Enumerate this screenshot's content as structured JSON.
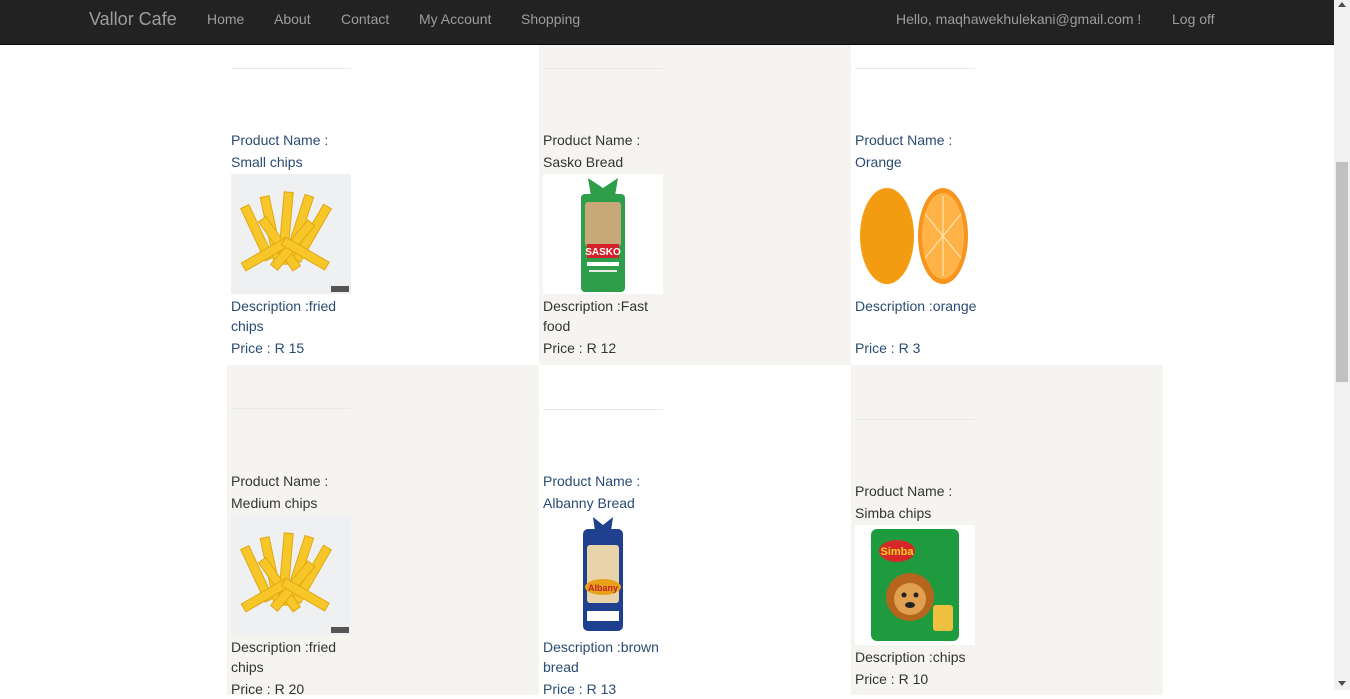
{
  "navbar": {
    "brand": "Vallor Cafe",
    "links": [
      "Home",
      "About",
      "Contact",
      "My Account",
      "Shopping"
    ],
    "greeting": "Hello, maqhawekhulekani@gmail.com !",
    "logoff": "Log off"
  },
  "labels": {
    "name": "Product Name :",
    "price_prefix": "Price : R "
  },
  "products": [
    {
      "name": "Small chips",
      "description": "Description :fried chips",
      "price": "Price : R 15",
      "image": "fries-image"
    },
    {
      "name": "Sasko Bread",
      "description": "Description :Fast food",
      "price": "Price : R 12",
      "image": "sasko-bread-image"
    },
    {
      "name": "Orange",
      "description": "Description :orange",
      "price": "Price : R 3",
      "image": "orange-image"
    },
    {
      "name": "Medium chips",
      "description": "Description :fried chips",
      "price": "Price : R 20",
      "image": "fries-image"
    },
    {
      "name": "Albanny Bread",
      "description": "Description :brown bread",
      "price": "Price : R 13",
      "image": "albany-bread-image"
    },
    {
      "name": "Simba chips",
      "description": "Description :chips",
      "price": "Price : R 10",
      "image": "simba-chips-image"
    }
  ],
  "colors": {
    "navbar_bg": "#222222",
    "nav_text": "#9d9d9d",
    "shaded_cell": "#f5f4f1",
    "link_blue": "#2a4b73"
  }
}
